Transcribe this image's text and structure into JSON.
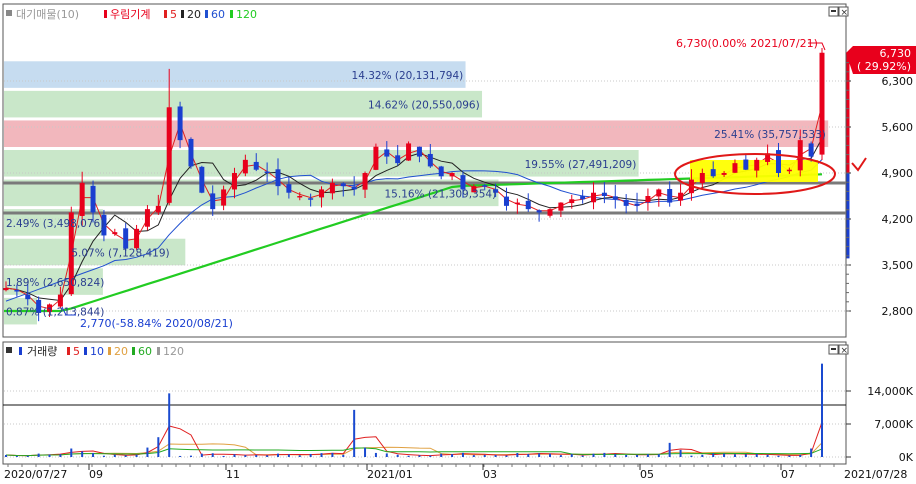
{
  "price_panel": {
    "legend": {
      "title": "대기매물(10)",
      "indicator": "우림기계",
      "ma5": "5",
      "ma20": "20",
      "ma60": "60",
      "ma120": "120"
    },
    "y_ticks": [
      "6,300",
      "5,600",
      "4,900",
      "4,200",
      "3,500",
      "2,800"
    ],
    "last_price_label": "6,730",
    "last_change_label": "( 29.92%)",
    "max_annotation": "6,730(0.00% 2021/07/21)",
    "min_annotation": "2,770(-58.84% 2020/08/21)"
  },
  "volume_panel": {
    "legend": {
      "title": "거래량",
      "ma5": "5",
      "ma10": "10",
      "ma20": "20",
      "ma60": "60",
      "ma120": "120"
    },
    "y_ticks": [
      "14,000K",
      "7,000K",
      "0K"
    ]
  },
  "x_axis": {
    "start_label": "2020/07/27",
    "end_label": "2021/07/28",
    "tick_labels": [
      "09",
      "11",
      "2021/01",
      "03",
      "05",
      "07"
    ]
  },
  "colors": {
    "up": "#e8001c",
    "down": "#1a3fd0",
    "ma5": "#e02020",
    "ma20": "#222222",
    "ma60": "#2050d0",
    "ma120": "#22cc22",
    "volume_bar": "#1a4ad0"
  },
  "chart_data": [
    {
      "type": "candlestick",
      "title": "우림기계",
      "x_range": [
        "2020/07/27",
        "2021/07/28"
      ],
      "ylim": [
        2550,
        6950
      ],
      "close": [
        3150,
        3100,
        2980,
        2770,
        2900,
        3050,
        4300,
        4750,
        4300,
        3950,
        4000,
        3750,
        4050,
        4350,
        4400,
        5900,
        5400,
        5000,
        4600,
        4350,
        4650,
        4900,
        5100,
        4950,
        4900,
        4700,
        4600,
        4550,
        4500,
        4650,
        4750,
        4700,
        4650,
        4900,
        5300,
        5150,
        5050,
        5350,
        5150,
        5000,
        4850,
        4900,
        4650,
        4700,
        4700,
        4600,
        4400,
        4450,
        4350,
        4300,
        4350,
        4450,
        4500,
        4500,
        4600,
        4550,
        4500,
        4400,
        4400,
        4550,
        4650,
        4450,
        4600,
        4800,
        4900,
        4850,
        4900,
        5050,
        4950,
        5100,
        5200,
        4900,
        4950,
        5400,
        5150,
        6730
      ],
      "volume_labels": [
        "14,000K",
        "7,000K",
        "0K"
      ]
    },
    {
      "type": "bar",
      "title": "거래량",
      "units": "K",
      "ylim": [
        0,
        20000
      ],
      "peaks": [
        {
          "date": "2020/09",
          "value": 1800
        },
        {
          "date": "2020/10",
          "value": 13500
        },
        {
          "date": "2021/01",
          "value": 10000
        },
        {
          "date": "2021/04",
          "value": 3000
        },
        {
          "date": "2021/07/21",
          "value": 19800
        }
      ]
    }
  ],
  "volume_profile": [
    {
      "label": "14.32% (20,131,794)",
      "price_lo": 6150,
      "price_hi": 6600,
      "width": 0.56,
      "color": "#c6dcf0"
    },
    {
      "label": "14.62% (20,550,096)",
      "price_lo": 5700,
      "price_hi": 6150,
      "width": 0.58,
      "color": "#c9e7c9"
    },
    {
      "label": "25.41% (35,757,533)",
      "price_lo": 5250,
      "price_hi": 5700,
      "width": 1.0,
      "color": "#f2b7bd"
    },
    {
      "label": "19.55% (27,491,209)",
      "price_lo": 4800,
      "price_hi": 5250,
      "width": 0.77,
      "color": "#c9e7c9"
    },
    {
      "label": "15.16% (21,309,354)",
      "price_lo": 4350,
      "price_hi": 4800,
      "width": 0.6,
      "color": "#c9e7c9"
    },
    {
      "label": "2.49% (3,498,076)",
      "price_lo": 3900,
      "price_hi": 4350,
      "width": 0.12,
      "color": "#c9e7c9"
    },
    {
      "label": "5.07% (7,128,419)",
      "price_lo": 3450,
      "price_hi": 3900,
      "width": 0.22,
      "color": "#c9e7c9"
    },
    {
      "label": "1.89% (2,650,824)",
      "price_lo": 3000,
      "price_hi": 3450,
      "width": 0.12,
      "color": "#c9e7c9"
    },
    {
      "label": "0.87% (1,213,844)",
      "price_lo": 2550,
      "price_hi": 3000,
      "width": 0.04,
      "color": "#c9e7c9"
    }
  ]
}
